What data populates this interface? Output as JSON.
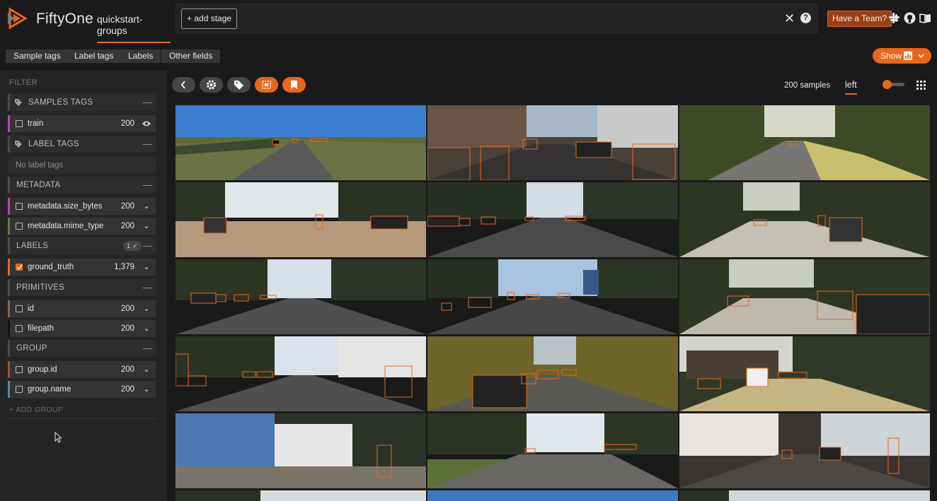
{
  "header": {
    "brand": "FiftyOne",
    "dataset": "quickstart-groups",
    "add_stage": "+ add stage",
    "close_symbol": "✕",
    "help_symbol": "?",
    "team_button": "Have a Team?",
    "icons": [
      "slack-icon",
      "github-icon",
      "docs-icon"
    ]
  },
  "field_tabs": [
    "Sample tags",
    "Label tags",
    "Labels",
    "Other fields"
  ],
  "show_button": "Show",
  "sidebar": {
    "filter_label": "FILTER",
    "groups": {
      "sample_tags": "SAMPLES TAGS",
      "label_tags": "LABEL TAGS",
      "metadata": "METADATA",
      "labels": "LABELS",
      "primitives": "PRIMITIVES",
      "group": "GROUP"
    },
    "no_label_tags": "No label tags",
    "labels_badge": "1 ✓",
    "fields": [
      {
        "name": "train",
        "count": "200",
        "color": "#c43fbe",
        "checked": false
      },
      {
        "name": "metadata.size_bytes",
        "count": "200",
        "color": "#c43fbe",
        "checked": false
      },
      {
        "name": "metadata.mime_type",
        "count": "200",
        "color": "#5c7d3c",
        "checked": false
      },
      {
        "name": "ground_truth",
        "count": "1,379",
        "color": "#e8671d",
        "checked": true
      },
      {
        "name": "id",
        "count": "200",
        "color": "#8a6a3a",
        "checked": false
      },
      {
        "name": "filepath",
        "count": "200",
        "color": "#111111",
        "checked": false
      },
      {
        "name": "group.id",
        "count": "200",
        "color": "#b8481c",
        "checked": false
      },
      {
        "name": "group.name",
        "count": "200",
        "color": "#4d8ca3",
        "checked": false
      }
    ],
    "add_group": "+ ADD GROUP"
  },
  "toolbar": {
    "samples_count": "200 samples",
    "slice": "left"
  },
  "colors": {
    "accent": "#e8671d",
    "background": "#1a1a1a",
    "sidebar": "#252525"
  }
}
